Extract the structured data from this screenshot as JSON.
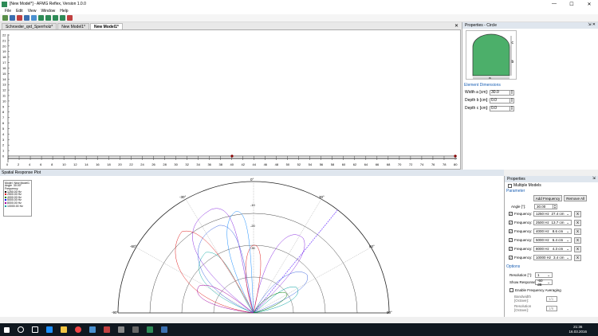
{
  "window": {
    "title": "[New Model*] - AFMG Reflex, Version 1.0.0",
    "minimize": "—",
    "maximize": "☐",
    "close": "✕"
  },
  "menu": [
    "File",
    "Edit",
    "View",
    "Window",
    "Help"
  ],
  "tabs": [
    "Schroeder_qrd_Sperrholz*",
    "New Model1*",
    "New Model1*"
  ],
  "top_plot": {
    "y_ticks": [
      "22",
      "21",
      "20",
      "19",
      "18",
      "17",
      "16",
      "15",
      "14",
      "13",
      "12",
      "11",
      "10",
      "9",
      "8",
      "7",
      "6",
      "5",
      "4",
      "3",
      "2",
      "1",
      "0"
    ],
    "x_ticks": [
      "0",
      "2",
      "4",
      "6",
      "8",
      "10",
      "12",
      "14",
      "16",
      "18",
      "20",
      "22",
      "24",
      "26",
      "28",
      "30",
      "32",
      "34",
      "36",
      "38",
      "40",
      "42",
      "44",
      "46",
      "48",
      "50",
      "52",
      "54",
      "56",
      "58",
      "60",
      "62",
      "64",
      "66",
      "68",
      "70",
      "72",
      "74",
      "76",
      "78",
      "80"
    ]
  },
  "properties_circle": {
    "header": "Properties - Circle",
    "labels": {
      "a": "a",
      "b": "b",
      "c": "c"
    },
    "section": "Element Dimensions",
    "fields": [
      {
        "label": "Width a [cm]:",
        "value": "30.0"
      },
      {
        "label": "Depth b [cm]:",
        "value": "0.0"
      },
      {
        "label": "Depth c [cm]:",
        "value": "0.0"
      }
    ]
  },
  "spatial": {
    "header": "Spatial Response Plot",
    "legend": {
      "model_label": "Model",
      "model_value": "New Model1",
      "angle_label": "Angle",
      "angle_value": "30.00°",
      "freq_label": "Frequency",
      "items": [
        {
          "text": "1250.00 Hz",
          "color": "#000000"
        },
        {
          "text": "2500.00 Hz",
          "color": "#e00000"
        },
        {
          "text": "4000.00 Hz",
          "color": "#008000"
        },
        {
          "text": "5000.00 Hz",
          "color": "#0000ff"
        },
        {
          "text": "8000.00 Hz",
          "color": "#a000a0"
        },
        {
          "text": "10000.00 Hz",
          "color": "#00a0a0"
        }
      ]
    },
    "angles": [
      "0°",
      "-30°",
      "30°",
      "-60°",
      "60°",
      "-90°",
      "90°"
    ],
    "db_ticks": [
      "-10",
      "-20",
      "-30"
    ]
  },
  "bottom_props": {
    "header": "Properties",
    "multiple_models": "Multiple Models",
    "parameter": "Parameter",
    "add_frequency": "Add Frequency",
    "remove_all": "Remove All",
    "angle_label": "Angle [°]:",
    "angle_value": "30.00",
    "frequencies": [
      {
        "label": "Frequency:",
        "hz": "1250 Hz",
        "cm": "27.4 cm"
      },
      {
        "label": "Frequency:",
        "hz": "2500 Hz",
        "cm": "13.7 cm"
      },
      {
        "label": "Frequency:",
        "hz": "4000 Hz",
        "cm": "8.6 cm"
      },
      {
        "label": "Frequency:",
        "hz": "5000 Hz",
        "cm": "6.4 cm"
      },
      {
        "label": "Frequency:",
        "hz": "8000 Hz",
        "cm": "4.3 cm"
      },
      {
        "label": "Frequency:",
        "hz": "10000 Hz",
        "cm": "3.4 cm"
      }
    ],
    "remove_x": "X",
    "options": "Options",
    "resolution_label": "Resolution [°]:",
    "resolution_value": "1",
    "show_response_label": "Show Response down to:",
    "show_response_value": "-60 dB",
    "enable_averaging": "Enable Frequency Averaging",
    "bandwidth_label": "Bandwidth [Octave]:",
    "bandwidth_value": "1/1",
    "resolution_oct_label": "Resolution [Octave]:",
    "resolution_oct_value": "1/6"
  },
  "taskbar": {
    "time": "21:36",
    "date": "16.03.2016"
  }
}
